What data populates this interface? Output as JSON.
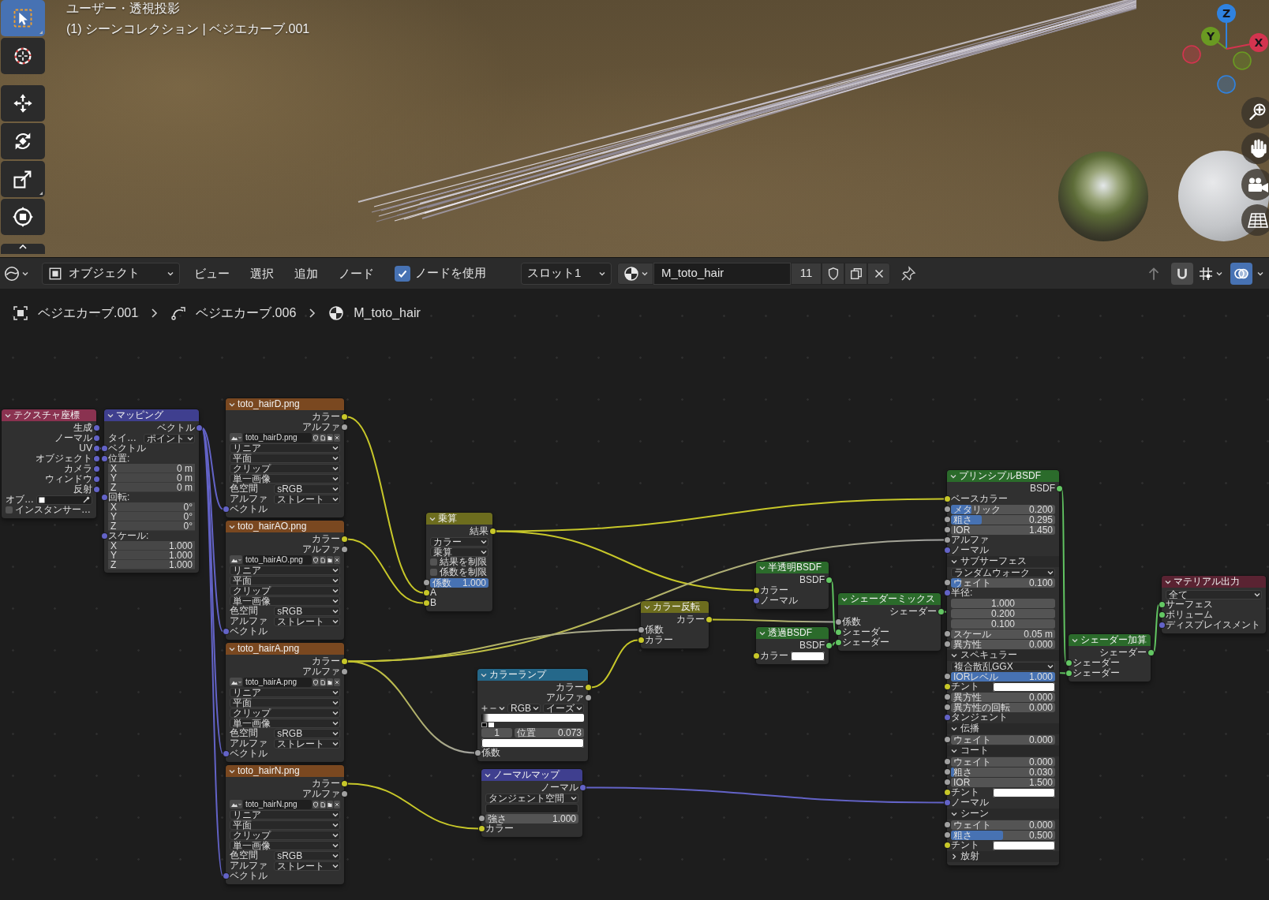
{
  "viewport": {
    "view_name": "ユーザー・透視投影",
    "scene_info": "(1) シーンコレクション | ベジエカーブ.001",
    "tools": [
      {
        "kind": "select",
        "selected": true
      },
      {
        "kind": "cursor",
        "selected": false
      },
      {
        "kind": "move",
        "selected": false
      },
      {
        "kind": "rotate",
        "selected": false
      },
      {
        "kind": "scale",
        "selected": false
      },
      {
        "kind": "transform",
        "selected": false
      },
      {
        "kind": "more",
        "selected": false
      }
    ],
    "axes": [
      {
        "label": "Z",
        "color": "#2f82e0"
      },
      {
        "label": "Y",
        "color": "#6a9a22"
      },
      {
        "label": "X",
        "color": "#d3344f"
      }
    ]
  },
  "header": {
    "mode": "オブジェクト",
    "menus": [
      "ビュー",
      "選択",
      "追加",
      "ノード"
    ],
    "use_nodes": {
      "label": "ノードを使用",
      "checked": true
    },
    "slot": "スロット1",
    "material": {
      "name": "M_toto_hair",
      "users": "11"
    },
    "toggles": [
      {
        "kind": "parent",
        "disabled": true
      },
      {
        "kind": "snap",
        "on": false
      },
      {
        "kind": "snap_target"
      },
      {
        "kind": "overlays",
        "on": true
      }
    ]
  },
  "breadcrumbs": [
    {
      "kind": "object",
      "label": "ベジエカーブ.001"
    },
    {
      "kind": "curve",
      "label": "ベジエカーブ.006"
    },
    {
      "kind": "material",
      "label": "M_toto_hair"
    }
  ],
  "nodes": [
    {
      "title": "テクスチャ座標",
      "color": "#8a3250",
      "rows": [
        {
          "kind": "output",
          "label": "生成",
          "socket": {
            "color": "#6363c7"
          }
        },
        {
          "kind": "output",
          "label": "ノーマル",
          "socket": {
            "color": "#6363c7"
          }
        },
        {
          "kind": "output",
          "label": "UV",
          "socket": {
            "color": "#6363c7"
          }
        },
        {
          "kind": "output",
          "label": "オブジェクト",
          "socket": {
            "color": "#6363c7"
          }
        },
        {
          "kind": "output",
          "label": "カメラ",
          "socket": {
            "color": "#6363c7"
          }
        },
        {
          "kind": "output",
          "label": "ウィンドウ",
          "socket": {
            "color": "#6363c7"
          }
        },
        {
          "kind": "output",
          "label": "反射",
          "socket": {
            "color": "#6363c7"
          }
        },
        {
          "kind": "object_field",
          "label": "オブ…"
        },
        {
          "kind": "checkbox",
          "label": "インスタンサー…",
          "checked": false
        }
      ]
    },
    {
      "title": "マッピング",
      "color": "#3f3f8f",
      "rows": [
        {
          "kind": "output",
          "label": "ベクトル",
          "socket": {
            "color": "#6363c7"
          }
        },
        {
          "kind": "dropdown",
          "label": "タイ…",
          "value": "ポイント"
        },
        {
          "kind": "input",
          "label": "ベクトル",
          "socket": {
            "color": "#6363c7"
          }
        },
        {
          "kind": "input",
          "label": "位置:",
          "socket": {
            "color": "#6363c7"
          }
        },
        {
          "kind": "vector_field",
          "axis": "X",
          "value": "0 m"
        },
        {
          "kind": "vector_field",
          "axis": "Y",
          "value": "0 m"
        },
        {
          "kind": "vector_field",
          "axis": "Z",
          "value": "0 m"
        },
        {
          "kind": "input",
          "label": "回転:",
          "socket": {
            "color": "#6363c7"
          }
        },
        {
          "kind": "vector_field",
          "axis": "X",
          "value": "0°"
        },
        {
          "kind": "vector_field",
          "axis": "Y",
          "value": "0°"
        },
        {
          "kind": "vector_field",
          "axis": "Z",
          "value": "0°"
        },
        {
          "kind": "input",
          "label": "スケール:",
          "socket": {
            "color": "#6363c7"
          }
        },
        {
          "kind": "vector_field",
          "axis": "X",
          "value": "1.000"
        },
        {
          "kind": "vector_field",
          "axis": "Y",
          "value": "1.000"
        },
        {
          "kind": "vector_field",
          "axis": "Z",
          "value": "1.000"
        }
      ]
    },
    {
      "title": "toto_hairD.png",
      "color": "#7a4820",
      "rows": [
        {
          "kind": "output",
          "label": "カラー",
          "socket": {
            "color": "#c7c729"
          }
        },
        {
          "kind": "output",
          "label": "アルファ",
          "socket": {
            "color": "#a1a1a1"
          }
        },
        {
          "kind": "image_field",
          "value": "toto_hairD.png"
        },
        {
          "kind": "dropdown",
          "value": "リニア"
        },
        {
          "kind": "dropdown",
          "value": "平面"
        },
        {
          "kind": "dropdown",
          "value": "クリップ"
        },
        {
          "kind": "dropdown",
          "value": "単一画像"
        },
        {
          "kind": "dropdown",
          "label": "色空間",
          "value": "sRGB"
        },
        {
          "kind": "dropdown",
          "label": "アルファ",
          "value": "ストレート"
        },
        {
          "kind": "input",
          "label": "ベクトル",
          "socket": {
            "color": "#6363c7"
          }
        }
      ]
    },
    {
      "title": "toto_hairAO.png",
      "color": "#7a4820",
      "rows": [
        {
          "kind": "output",
          "label": "カラー",
          "socket": {
            "color": "#c7c729"
          }
        },
        {
          "kind": "output",
          "label": "アルファ",
          "socket": {
            "color": "#a1a1a1"
          }
        },
        {
          "kind": "image_field",
          "value": "toto_hairAO.png"
        },
        {
          "kind": "dropdown",
          "value": "リニア"
        },
        {
          "kind": "dropdown",
          "value": "平面"
        },
        {
          "kind": "dropdown",
          "value": "クリップ"
        },
        {
          "kind": "dropdown",
          "value": "単一画像"
        },
        {
          "kind": "dropdown",
          "label": "色空間",
          "value": "sRGB"
        },
        {
          "kind": "dropdown",
          "label": "アルファ",
          "value": "ストレート"
        },
        {
          "kind": "input",
          "label": "ベクトル",
          "socket": {
            "color": "#6363c7"
          }
        }
      ]
    },
    {
      "title": "toto_hairA.png",
      "color": "#7a4820",
      "rows": [
        {
          "kind": "output",
          "label": "カラー",
          "socket": {
            "color": "#c7c729"
          }
        },
        {
          "kind": "output",
          "label": "アルファ",
          "socket": {
            "color": "#a1a1a1"
          }
        },
        {
          "kind": "image_field",
          "value": "toto_hairA.png"
        },
        {
          "kind": "dropdown",
          "value": "リニア"
        },
        {
          "kind": "dropdown",
          "value": "平面"
        },
        {
          "kind": "dropdown",
          "value": "クリップ"
        },
        {
          "kind": "dropdown",
          "value": "単一画像"
        },
        {
          "kind": "dropdown",
          "label": "色空間",
          "value": "sRGB"
        },
        {
          "kind": "dropdown",
          "label": "アルファ",
          "value": "ストレート"
        },
        {
          "kind": "input",
          "label": "ベクトル",
          "socket": {
            "color": "#6363c7"
          }
        }
      ]
    },
    {
      "title": "toto_hairN.png",
      "color": "#7a4820",
      "rows": [
        {
          "kind": "output",
          "label": "カラー",
          "socket": {
            "color": "#c7c729"
          }
        },
        {
          "kind": "output",
          "label": "アルファ",
          "socket": {
            "color": "#a1a1a1"
          }
        },
        {
          "kind": "image_field",
          "value": "toto_hairN.png"
        },
        {
          "kind": "dropdown",
          "value": "リニア"
        },
        {
          "kind": "dropdown",
          "value": "平面"
        },
        {
          "kind": "dropdown",
          "value": "クリップ"
        },
        {
          "kind": "dropdown",
          "value": "単一画像"
        },
        {
          "kind": "dropdown",
          "label": "色空間",
          "value": "sRGB"
        },
        {
          "kind": "dropdown",
          "label": "アルファ",
          "value": "ストレート"
        },
        {
          "kind": "input",
          "label": "ベクトル",
          "socket": {
            "color": "#6363c7"
          }
        }
      ]
    },
    {
      "title": "乗算",
      "color": "#6d6d1e",
      "rows": [
        {
          "kind": "output",
          "label": "結果",
          "socket": {
            "color": "#c7c729"
          }
        },
        {
          "kind": "dropdown",
          "value": "カラー"
        },
        {
          "kind": "dropdown",
          "value": "乗算"
        },
        {
          "kind": "checkbox",
          "label": "結果を制限",
          "checked": false
        },
        {
          "kind": "checkbox",
          "label": "係数を制限",
          "checked": false
        },
        {
          "kind": "slider",
          "label": "係数",
          "value": "1.000",
          "level": 1,
          "socket": {
            "color": "#a1a1a1"
          }
        },
        {
          "kind": "input",
          "label": "A",
          "socket": {
            "color": "#c7c729"
          }
        },
        {
          "kind": "input",
          "label": "B",
          "socket": {
            "color": "#c7c729"
          }
        }
      ]
    },
    {
      "title": "カラーランプ",
      "color": "#25688a",
      "rows": [
        {
          "kind": "output",
          "label": "カラー",
          "socket": {
            "color": "#c7c729"
          }
        },
        {
          "kind": "output",
          "label": "アルファ",
          "socket": {
            "color": "#a1a1a1"
          }
        },
        {
          "kind": "ramp_toolbar",
          "color_mode": "RGB",
          "interpolation": "イーズ"
        },
        {
          "kind": "ramp_bar",
          "stops": [
            {
              "color": "#000000",
              "level": 0,
              "selected": false
            },
            {
              "color": "#ffffff",
              "level": 0.073,
              "selected": true
            }
          ]
        },
        {
          "kind": "ramp_stop",
          "index": "1",
          "label": "位置",
          "value": "0.073"
        },
        {
          "kind": "swatch",
          "color": "#ffffff"
        },
        {
          "kind": "input",
          "label": "係数",
          "socket": {
            "color": "#a1a1a1"
          }
        }
      ]
    },
    {
      "title": "ノーマルマップ",
      "color": "#3f3f8f",
      "rows": [
        {
          "kind": "output",
          "label": "ノーマル",
          "socket": {
            "color": "#6363c7"
          }
        },
        {
          "kind": "dropdown",
          "value": "タンジェント空間"
        },
        {
          "kind": "text_field"
        },
        {
          "kind": "number",
          "label": "強さ",
          "value": "1.000",
          "socket": {
            "color": "#a1a1a1"
          }
        },
        {
          "kind": "input",
          "label": "カラー",
          "socket": {
            "color": "#c7c729"
          }
        }
      ]
    },
    {
      "title": "カラー反転",
      "color": "#6d6d1e",
      "rows": [
        {
          "kind": "output",
          "label": "カラー",
          "socket": {
            "color": "#c7c729"
          }
        },
        {
          "kind": "input",
          "label": "係数",
          "socket": {
            "color": "#a1a1a1"
          }
        },
        {
          "kind": "input",
          "label": "カラー",
          "socket": {
            "color": "#c7c729"
          }
        }
      ]
    },
    {
      "title": "半透明BSDF",
      "color": "#2b6b2b",
      "rows": [
        {
          "kind": "output",
          "label": "BSDF",
          "socket": {
            "color": "#63c763"
          }
        },
        {
          "kind": "input",
          "label": "カラー",
          "socket": {
            "color": "#c7c729"
          }
        },
        {
          "kind": "input",
          "label": "ノーマル",
          "socket": {
            "color": "#6363c7"
          }
        }
      ]
    },
    {
      "title": "透過BSDF",
      "color": "#2b6b2b",
      "rows": [
        {
          "kind": "output",
          "label": "BSDF",
          "socket": {
            "color": "#63c763"
          }
        },
        {
          "kind": "color_input",
          "label": "カラー",
          "color": "#ffffff",
          "socket": {
            "color": "#c7c729"
          }
        }
      ]
    },
    {
      "title": "シェーダーミックス",
      "color": "#2b6b2b",
      "rows": [
        {
          "kind": "output",
          "label": "シェーダー",
          "socket": {
            "color": "#63c763"
          }
        },
        {
          "kind": "input",
          "label": "係数",
          "socket": {
            "color": "#a1a1a1"
          }
        },
        {
          "kind": "input",
          "label": "シェーダー",
          "socket": {
            "color": "#63c763"
          }
        },
        {
          "kind": "input",
          "label": "シェーダー",
          "socket": {
            "color": "#63c763"
          }
        }
      ]
    },
    {
      "title": "プリンシプルBSDF",
      "color": "#2b6b2b",
      "rows": [
        {
          "kind": "output",
          "label": "BSDF",
          "socket": {
            "color": "#63c763"
          }
        },
        {
          "kind": "input",
          "label": "ベースカラー",
          "socket": {
            "color": "#c7c729"
          }
        },
        {
          "kind": "slider",
          "label": "メタリック",
          "value": "0.200",
          "level": 0.2,
          "socket": {
            "color": "#a1a1a1"
          }
        },
        {
          "kind": "slider",
          "label": "粗さ",
          "value": "0.295",
          "level": 0.295,
          "socket": {
            "color": "#a1a1a1"
          }
        },
        {
          "kind": "number",
          "label": "IOR",
          "value": "1.450",
          "socket": {
            "color": "#a1a1a1"
          }
        },
        {
          "kind": "input",
          "label": "アルファ",
          "socket": {
            "color": "#a1a1a1"
          }
        },
        {
          "kind": "input",
          "label": "ノーマル",
          "socket": {
            "color": "#6363c7"
          }
        },
        {
          "kind": "panel",
          "label": "サブサーフェス",
          "expanded": true
        },
        {
          "kind": "dropdown",
          "value": "ランダムウォーク"
        },
        {
          "kind": "slider",
          "label": "ウェイト",
          "value": "0.100",
          "level": 0.1,
          "socket": {
            "color": "#a1a1a1"
          }
        },
        {
          "kind": "input",
          "label": "半径:",
          "socket": {
            "color": "#6363c7"
          }
        },
        {
          "kind": "number",
          "value": "1.000"
        },
        {
          "kind": "number",
          "value": "0.200"
        },
        {
          "kind": "number",
          "value": "0.100"
        },
        {
          "kind": "number",
          "label": "スケール",
          "value": "0.05 m",
          "socket": {
            "color": "#a1a1a1"
          }
        },
        {
          "kind": "number",
          "label": "異方性",
          "value": "0.000",
          "socket": {
            "color": "#a1a1a1"
          }
        },
        {
          "kind": "panel",
          "label": "スペキュラー",
          "expanded": true
        },
        {
          "kind": "dropdown",
          "value": "複合散乱GGX"
        },
        {
          "kind": "slider",
          "label": "IORレベル",
          "value": "1.000",
          "level": 1,
          "socket": {
            "color": "#a1a1a1"
          }
        },
        {
          "kind": "color_input",
          "label": "チント",
          "color": "#ffffff",
          "socket": {
            "color": "#c7c729"
          }
        },
        {
          "kind": "number",
          "label": "異方性",
          "value": "0.000",
          "socket": {
            "color": "#a1a1a1"
          }
        },
        {
          "kind": "number",
          "label": "異方性の回転",
          "value": "0.000",
          "socket": {
            "color": "#a1a1a1"
          }
        },
        {
          "kind": "input",
          "label": "タンジェント",
          "socket": {
            "color": "#6363c7"
          }
        },
        {
          "kind": "panel",
          "label": "伝播",
          "expanded": true
        },
        {
          "kind": "slider",
          "label": "ウェイト",
          "value": "0.000",
          "level": 0,
          "socket": {
            "color": "#a1a1a1"
          }
        },
        {
          "kind": "panel",
          "label": "コート",
          "expanded": true
        },
        {
          "kind": "slider",
          "label": "ウェイト",
          "value": "0.000",
          "level": 0,
          "socket": {
            "color": "#a1a1a1"
          }
        },
        {
          "kind": "slider",
          "label": "粗さ",
          "value": "0.030",
          "level": 0.03,
          "socket": {
            "color": "#a1a1a1"
          }
        },
        {
          "kind": "number",
          "label": "IOR",
          "value": "1.500",
          "socket": {
            "color": "#a1a1a1"
          }
        },
        {
          "kind": "color_input",
          "label": "チント",
          "color": "#ffffff",
          "socket": {
            "color": "#c7c729"
          }
        },
        {
          "kind": "input",
          "label": "ノーマル",
          "socket": {
            "color": "#6363c7"
          }
        },
        {
          "kind": "panel",
          "label": "シーン",
          "expanded": true
        },
        {
          "kind": "slider",
          "label": "ウェイト",
          "value": "0.000",
          "level": 0,
          "socket": {
            "color": "#a1a1a1"
          }
        },
        {
          "kind": "slider",
          "label": "粗さ",
          "value": "0.500",
          "level": 0.5,
          "socket": {
            "color": "#a1a1a1"
          }
        },
        {
          "kind": "color_input",
          "label": "チント",
          "color": "#ffffff",
          "socket": {
            "color": "#c7c729"
          }
        },
        {
          "kind": "panel",
          "label": "放射",
          "expanded": false
        }
      ]
    },
    {
      "title": "シェーダー加算",
      "color": "#2b6b2b",
      "rows": [
        {
          "kind": "output",
          "label": "シェーダー",
          "socket": {
            "color": "#63c763"
          }
        },
        {
          "kind": "input",
          "label": "シェーダー",
          "socket": {
            "color": "#63c763"
          }
        },
        {
          "kind": "input",
          "label": "シェーダー",
          "socket": {
            "color": "#63c763"
          }
        }
      ]
    },
    {
      "title": "マテリアル出力",
      "color": "#5a2332",
      "rows": [
        {
          "kind": "dropdown",
          "value": "全て"
        },
        {
          "kind": "input",
          "label": "サーフェス",
          "socket": {
            "color": "#63c763"
          }
        },
        {
          "kind": "input",
          "label": "ボリューム",
          "socket": {
            "color": "#63c763"
          }
        },
        {
          "kind": "input",
          "label": "ディスプレイスメント",
          "socket": {
            "color": "#6363c7"
          }
        }
      ]
    }
  ]
}
